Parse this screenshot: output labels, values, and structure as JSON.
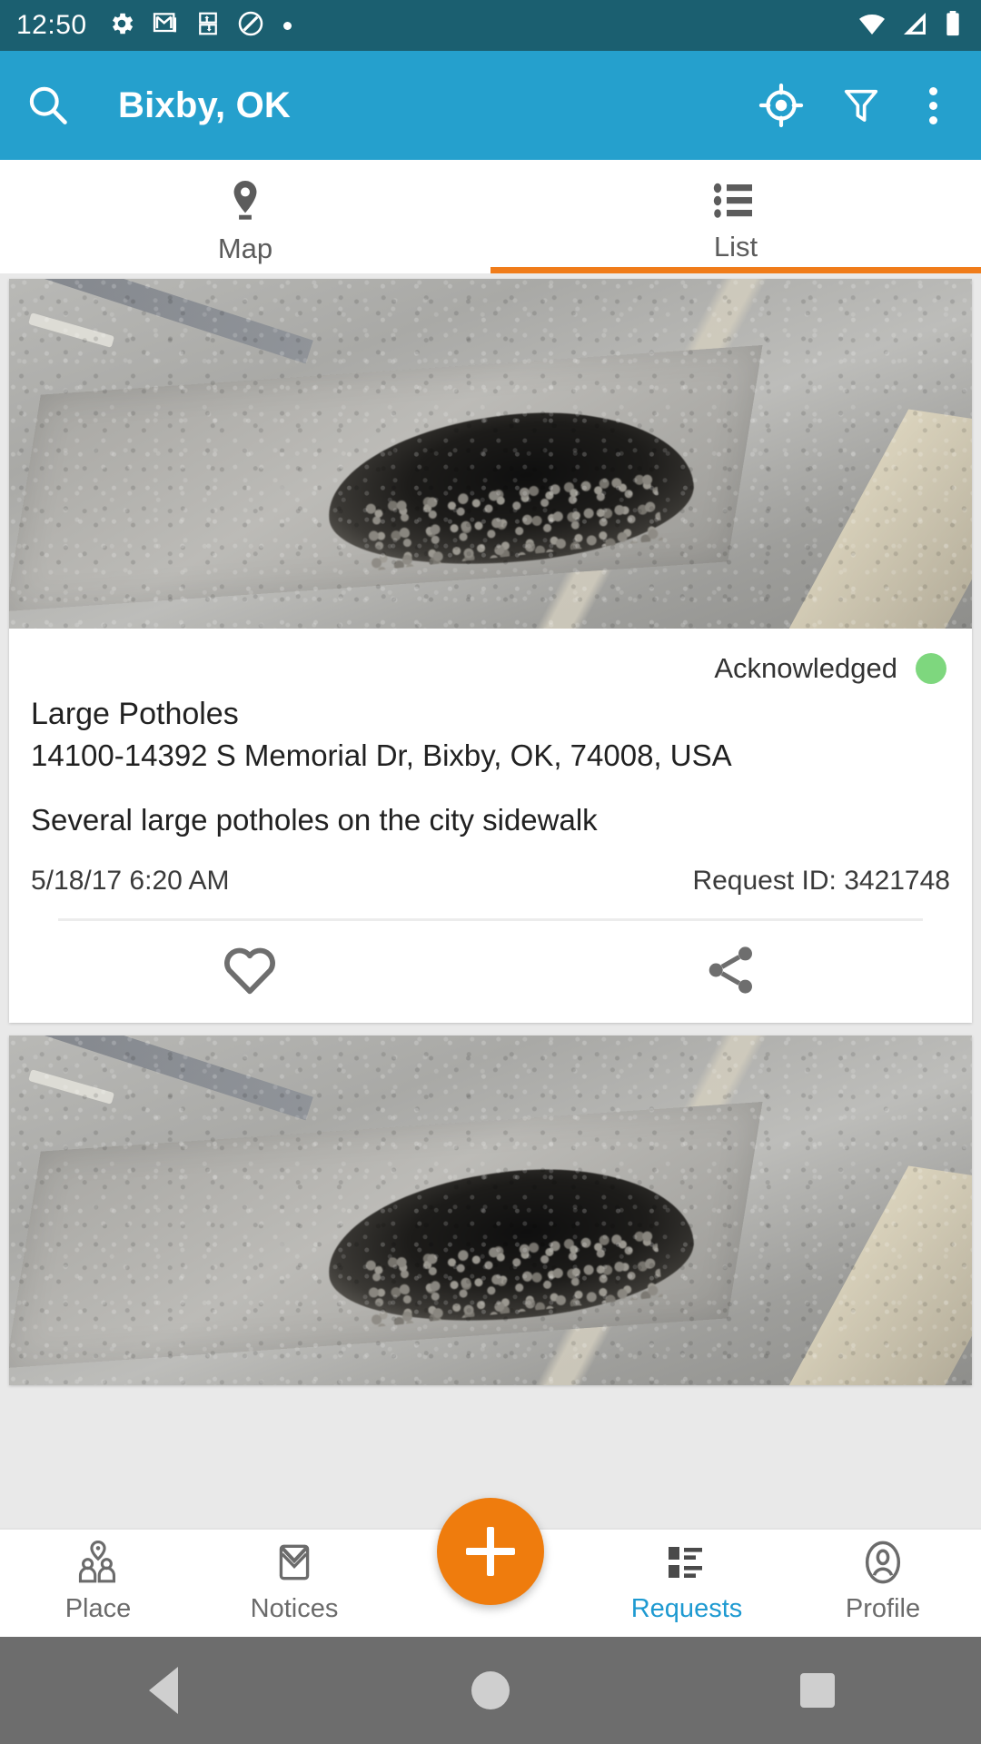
{
  "status_bar": {
    "time": "12:50",
    "icons_left": [
      "gear-icon",
      "gmail-icon",
      "sync-icon",
      "do-not-disturb-icon",
      "dot-icon"
    ],
    "icons_right": [
      "wifi-icon",
      "cell-signal-icon",
      "battery-icon"
    ],
    "background_color": "#1b5f70"
  },
  "app_bar": {
    "title": "Bixby, OK",
    "search_icon": "search-icon",
    "locate_icon": "my-location-icon",
    "filter_icon": "filter-funnel-icon",
    "overflow_icon": "more-vertical-icon",
    "background_color": "#25a0cd"
  },
  "tabs": {
    "active_index": 1,
    "indicator_color": "#f07c1a",
    "items": [
      {
        "label": "Map",
        "icon": "map-pin-icon"
      },
      {
        "label": "List",
        "icon": "list-icon"
      }
    ]
  },
  "requests": [
    {
      "photo_alt": "pothole-photo",
      "status": "Acknowledged",
      "status_color": "#7ed77e",
      "title": "Large Potholes",
      "address": "14100-14392 S Memorial Dr, Bixby, OK, 74008, USA",
      "description": "Several large potholes on the city sidewalk",
      "date": "5/18/17 6:20 AM",
      "request_id": "Request ID: 3421748",
      "favorite_icon": "heart-icon",
      "share_icon": "share-icon"
    },
    {
      "photo_alt": "pothole-photo"
    }
  ],
  "bottom_nav": {
    "active_label": "Requests",
    "active_color": "#1e9ad1",
    "fab": {
      "icon": "plus-icon",
      "color": "#ef7c0d"
    },
    "items": [
      {
        "label": "Place",
        "icon": "place-people-icon"
      },
      {
        "label": "Notices",
        "icon": "envelope-icon"
      },
      {
        "label": "Requests",
        "icon": "requests-list-icon"
      },
      {
        "label": "Profile",
        "icon": "profile-person-icon"
      }
    ]
  },
  "system_nav": {
    "back": "back-triangle-icon",
    "home": "home-circle-icon",
    "recents": "recents-square-icon",
    "background_color": "#6d6d6d"
  }
}
